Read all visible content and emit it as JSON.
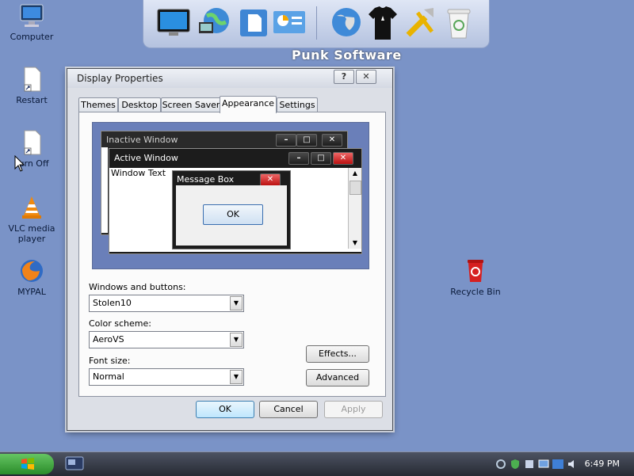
{
  "desktop": {
    "icons": [
      {
        "label": "Computer"
      },
      {
        "label": "Restart"
      },
      {
        "label": "Turn Off"
      },
      {
        "label": "VLC media player"
      },
      {
        "label": "MYPAL"
      },
      {
        "label": "Recycle Bin"
      }
    ]
  },
  "dock": {
    "title": "Punk Software",
    "items": [
      "monitor-icon",
      "network-globe-icon",
      "documents-icon",
      "control-panel-icon",
      "world-icon",
      "tshirt-icon",
      "tools-icon",
      "trash-icon"
    ]
  },
  "dialog": {
    "title": "Display Properties",
    "help": "?",
    "close": "✕",
    "tabs": [
      {
        "label": "Themes"
      },
      {
        "label": "Desktop"
      },
      {
        "label": "Screen Saver"
      },
      {
        "label": "Appearance"
      },
      {
        "label": "Settings"
      }
    ],
    "active_tab": "Appearance",
    "preview": {
      "inactive_window": "Inactive Window",
      "active_window": "Active Window",
      "window_text": "Window Text",
      "message_box": "Message Box",
      "ok": "OK"
    },
    "fields": {
      "windows_buttons_label": "Windows and buttons:",
      "windows_buttons_value": "Stolen10",
      "color_scheme_label": "Color scheme:",
      "color_scheme_value": "AeroVS",
      "font_size_label": "Font size:",
      "font_size_value": "Normal"
    },
    "buttons": {
      "effects": "Effects...",
      "advanced": "Advanced",
      "ok": "OK",
      "cancel": "Cancel",
      "apply": "Apply"
    }
  },
  "taskbar": {
    "clock": "6:49 PM"
  },
  "colors": {
    "desktop": "#7a93c7",
    "accent": "#3c7fb1"
  }
}
